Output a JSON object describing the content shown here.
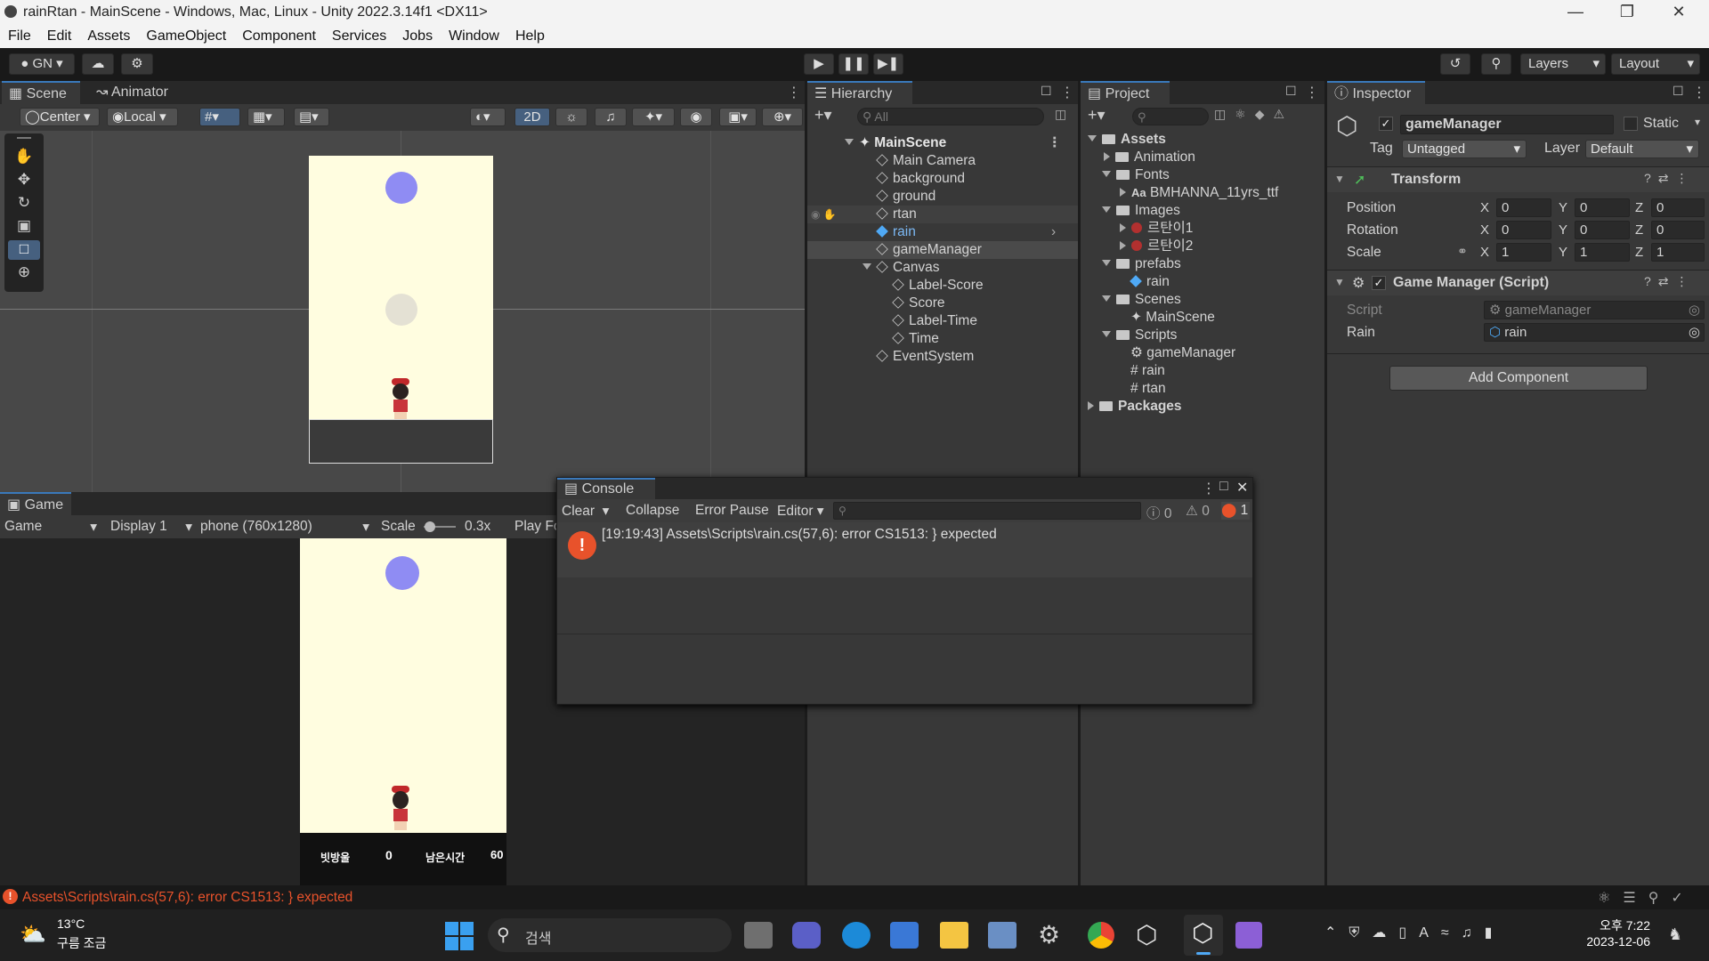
{
  "window": {
    "title": "rainRtan - MainScene - Windows, Mac, Linux - Unity 2022.3.14f1 <DX11>"
  },
  "menu": [
    "File",
    "Edit",
    "Assets",
    "GameObject",
    "Component",
    "Services",
    "Jobs",
    "Window",
    "Help"
  ],
  "toolbar": {
    "account": "GN",
    "layers": "Layers",
    "layout": "Layout"
  },
  "scene": {
    "tab": "Scene",
    "tab2": "Animator",
    "pivot": "Center",
    "space": "Local",
    "mode2d": "2D"
  },
  "hierarchy": {
    "tab": "Hierarchy",
    "search_placeholder": "All",
    "root": "MainScene",
    "items": [
      "Main Camera",
      "background",
      "ground",
      "rtan",
      "rain",
      "gameManager",
      "Canvas",
      "Label-Score",
      "Score",
      "Label-Time",
      "Time",
      "EventSystem"
    ]
  },
  "project": {
    "tab": "Project",
    "items": [
      "Assets",
      "Animation",
      "Fonts",
      "BMHANNA_11yrs_ttf",
      "Images",
      "르탄이1",
      "르탄이2",
      "prefabs",
      "rain",
      "Scenes",
      "MainScene",
      "Scripts",
      "gameManager",
      "rain",
      "rtan",
      "Packages"
    ],
    "font_prefix": "Aa"
  },
  "inspector": {
    "tab": "Inspector",
    "object_name": "gameManager",
    "static_label": "Static",
    "tag_label": "Tag",
    "tag_value": "Untagged",
    "layer_label": "Layer",
    "layer_value": "Default",
    "transform": {
      "title": "Transform",
      "position": "Position",
      "rotation": "Rotation",
      "scale": "Scale",
      "pos": [
        "0",
        "0",
        "0"
      ],
      "rot": [
        "0",
        "0",
        "0"
      ],
      "scl": [
        "1",
        "1",
        "1"
      ]
    },
    "axes": [
      "X",
      "Y",
      "Z"
    ],
    "script_comp": {
      "title": "Game Manager (Script)",
      "script_label": "Script",
      "script_value": "gameManager",
      "rain_label": "Rain",
      "rain_value": "rain"
    },
    "add_component": "Add Component"
  },
  "game": {
    "tab": "Game",
    "mode": "Game",
    "display": "Display 1",
    "resolution": "phone (760x1280)",
    "scale_label": "Scale",
    "scale_value": "0.3x",
    "play_focused": "Play Fo",
    "hud": [
      "빗방울",
      "0",
      "남은시간",
      "60"
    ]
  },
  "console": {
    "tab": "Console",
    "clear": "Clear",
    "collapse": "Collapse",
    "error_pause": "Error Pause",
    "editor": "Editor",
    "counts": [
      "0",
      "0",
      "1"
    ],
    "message": "[19:19:43] Assets\\Scripts\\rain.cs(57,6): error CS1513: } expected"
  },
  "statusbar": {
    "message": "Assets\\Scripts\\rain.cs(57,6): error CS1513: } expected"
  },
  "taskbar": {
    "temp": "13°C",
    "weather": "구름 조금",
    "search": "검색",
    "time": "오후 7:22",
    "date": "2023-12-06"
  },
  "colors": {
    "accent": "#3a79bb",
    "error": "#e8522b",
    "game_bg": "#fffde0",
    "rain_drop": "#8f8cf3"
  }
}
